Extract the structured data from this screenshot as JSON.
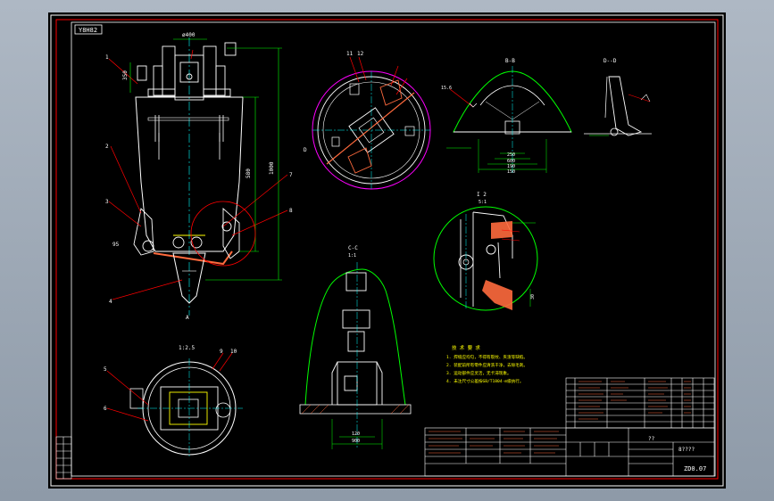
{
  "colors": {
    "background": "#000000",
    "border": "#ffffff",
    "frame": "#ff0000",
    "lines": "#ffffff",
    "dims": "#00ff00",
    "leaders": "#ff0000",
    "centerline": "#00ffff",
    "fill": "#ff6a3d",
    "notes": "#ffff00",
    "purple": "#ff00ff",
    "text": "#ffffff"
  },
  "drawing": {
    "code_box": "Y8H82",
    "drawing_number": "ZD0.07",
    "title_text": "8????",
    "title_secondary": "??",
    "view_labels": {
      "section_b": "B-B",
      "section_d": "D--D",
      "detail_1": "I 2",
      "detail_1_scale": "5:1",
      "section_c": "C-C",
      "section_c_scale": "1:1",
      "section_a": "A",
      "view_top": "1:2.5"
    },
    "part_numbers": [
      "1",
      "2",
      "3",
      "4",
      "5",
      "6",
      "7",
      "8",
      "9",
      "10",
      "11",
      "12"
    ],
    "dimensions": [
      "350",
      "580",
      "1000",
      "900",
      "250",
      "95",
      "600",
      "190",
      "150",
      "120",
      "15.6",
      "30",
      "ø400"
    ],
    "notes_title": "技 术 要 求",
    "notes": [
      "1. 焊缝应均匀，不得有裂纹、夹渣等缺陷。",
      "2. 装配前所有零件应清洗干净，去除毛刺。",
      "3. 运动部件应灵活，无卡滞现象。",
      "4. 未注尺寸公差按GB/T1804-m级执行。"
    ]
  }
}
